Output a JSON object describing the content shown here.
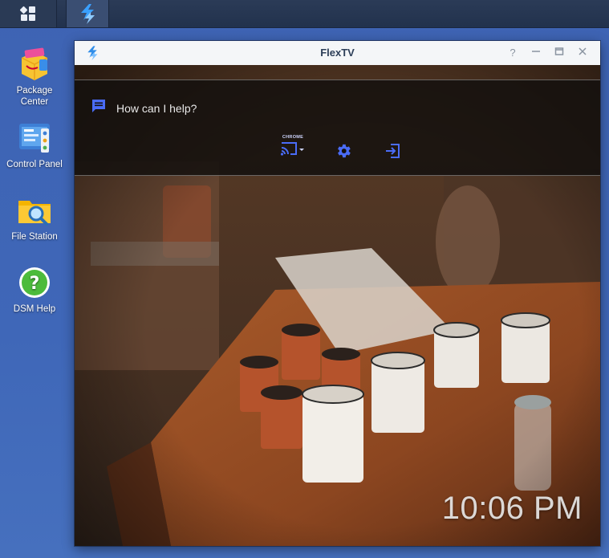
{
  "taskbar": {
    "main_menu_icon": "grid-icon",
    "active_app_icon": "flextv-logo-icon"
  },
  "desktop": {
    "icons": [
      {
        "name": "package-center",
        "label": "Package\nCenter",
        "line1": "Package",
        "line2": "Center"
      },
      {
        "name": "control-panel",
        "label": "Control Panel"
      },
      {
        "name": "file-station",
        "label": "File Station"
      },
      {
        "name": "dsm-help",
        "label": "DSM Help"
      }
    ]
  },
  "window": {
    "title": "FlexTV",
    "controls": {
      "help": "?",
      "minimize": "—",
      "maximize": "▭",
      "close": "✕"
    }
  },
  "app": {
    "help_prompt": "How can I help?",
    "cast_device_label": "CHROME",
    "icons": [
      "chat-icon",
      "cast-icon",
      "settings-icon",
      "logout-icon"
    ],
    "clock": "10:06 PM"
  },
  "colors": {
    "accent": "#4a6cf7",
    "desktop_bg": "#3f67b8",
    "taskbar_bg": "#22324d"
  }
}
